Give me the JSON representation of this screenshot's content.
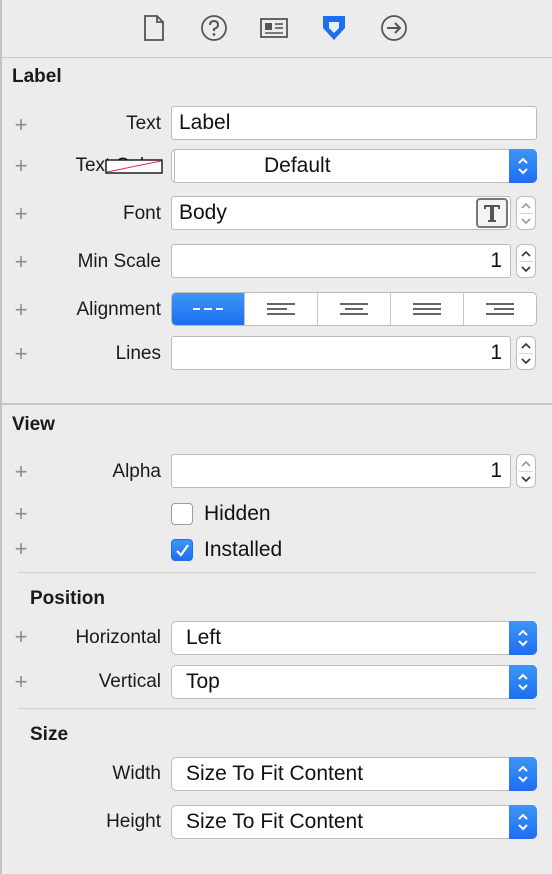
{
  "toolbar": {
    "tabs": [
      {
        "name": "file-inspector-icon"
      },
      {
        "name": "quick-help-icon"
      },
      {
        "name": "identity-inspector-icon"
      },
      {
        "name": "attributes-inspector-icon"
      },
      {
        "name": "connections-inspector-icon"
      }
    ],
    "active_tab": "attributes-inspector-icon",
    "accent": "#1d6ef0"
  },
  "label_section": {
    "title": "Label",
    "text_label": "Text",
    "text_value": "Label",
    "text_color_label": "Text Color",
    "text_color_value": "Default",
    "font_label": "Font",
    "font_value": "Body",
    "min_scale_label": "Min Scale",
    "min_scale_value": "1",
    "alignment_label": "Alignment",
    "alignment_options": [
      "natural",
      "left",
      "center",
      "justified",
      "right"
    ],
    "alignment_selected": "natural",
    "lines_label": "Lines",
    "lines_value": "1"
  },
  "view_section": {
    "title": "View",
    "alpha_label": "Alpha",
    "alpha_value": "1",
    "hidden_label": "Hidden",
    "hidden_checked": false,
    "installed_label": "Installed",
    "installed_checked": true
  },
  "position_section": {
    "title": "Position",
    "horizontal_label": "Horizontal",
    "horizontal_value": "Left",
    "vertical_label": "Vertical",
    "vertical_value": "Top"
  },
  "size_section": {
    "title": "Size",
    "width_label": "Width",
    "width_value": "Size To Fit Content",
    "height_label": "Height",
    "height_value": "Size To Fit Content"
  }
}
